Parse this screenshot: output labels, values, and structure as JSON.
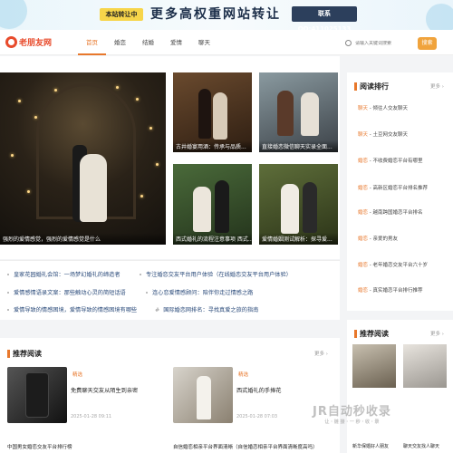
{
  "banner": {
    "tag": "本站转让中",
    "headline": "更多高权重网站转让",
    "contact": "联系QQ:411025133"
  },
  "header": {
    "logo_text": "老朋友网",
    "nav": [
      "首页",
      "婚恋",
      "结婚",
      "爱情",
      "聊天"
    ],
    "search_placeholder": "请输入关键词搜索",
    "search_button": "搜索"
  },
  "featured": {
    "big_caption": "强烈的爱情感觉，强烈的爱情感觉是什么",
    "cards": [
      {
        "caption": "古井婚宴用酒：传承与品质..."
      },
      {
        "caption": "直接婚恋微信聊天实录全面..."
      },
      {
        "caption": "西式婚礼的流程注意事项 西式..."
      },
      {
        "caption": "爱情婚姻测试解析：探寻爱..."
      }
    ]
  },
  "links": [
    "皇家花园婚礼会馆：一场梦幻婚礼的缔造者",
    "专注婚恋交友平台用户体验（在线婚恋交友平台用户体验）",
    "爱情感情语录文案：那些触动心灵的简短话语",
    "连心恋爱情感顾问：陪伴你走过情感之路",
    "爱情导致的情感困境，爱情导致的情感困境有哪些",
    "国际婚恋网排名：寻找真爱之旅的指南"
  ],
  "recommend": {
    "title": "推荐阅读",
    "more": "更多 ›",
    "cards": [
      {
        "tag": "精选",
        "title": "免费聊天交友从陌生到亲密",
        "date": "2025-01-28 09:11"
      },
      {
        "tag": "精选",
        "title": "西式婚礼的手捧花",
        "date": "2025-01-28 07:03"
      }
    ],
    "bottom_links": [
      "中国男女婚恋交友平台排行榜",
      "自信婚恋相亲平台界面清晰（自信婚恋相亲平台界面清晰度高吗）"
    ]
  },
  "sidebar": {
    "title": "阅读排行",
    "more": "更多 ›",
    "items": [
      {
        "tag": "聊天",
        "text": "倾往人交友聊天"
      },
      {
        "tag": "聊天",
        "text": "土豆网交友聊天"
      },
      {
        "tag": "婚恋",
        "text": "不收费婚恋平台有哪里"
      },
      {
        "tag": "婚恋",
        "text": "高新区婚恋平台排名推荐"
      },
      {
        "tag": "婚恋",
        "text": "越南跨国婚恋平台排名"
      },
      {
        "tag": "婚恋",
        "text": "亲爱的男友"
      },
      {
        "tag": "婚恋",
        "text": "老年婚恋交友平台六十岁"
      },
      {
        "tag": "婚恋",
        "text": "真实婚恋平台排行推荐"
      }
    ],
    "recommend_title": "推荐阅读",
    "recommend_more": "更多 ›",
    "recommend_cards": [
      {
        "title": "新华保婚好人朋友"
      },
      {
        "title": "聊天交友找人聊天"
      }
    ]
  },
  "watermark": {
    "main": "JR自动秒收录",
    "sub": "让 · 链 接 · 一 秒 · 收 · 录"
  }
}
